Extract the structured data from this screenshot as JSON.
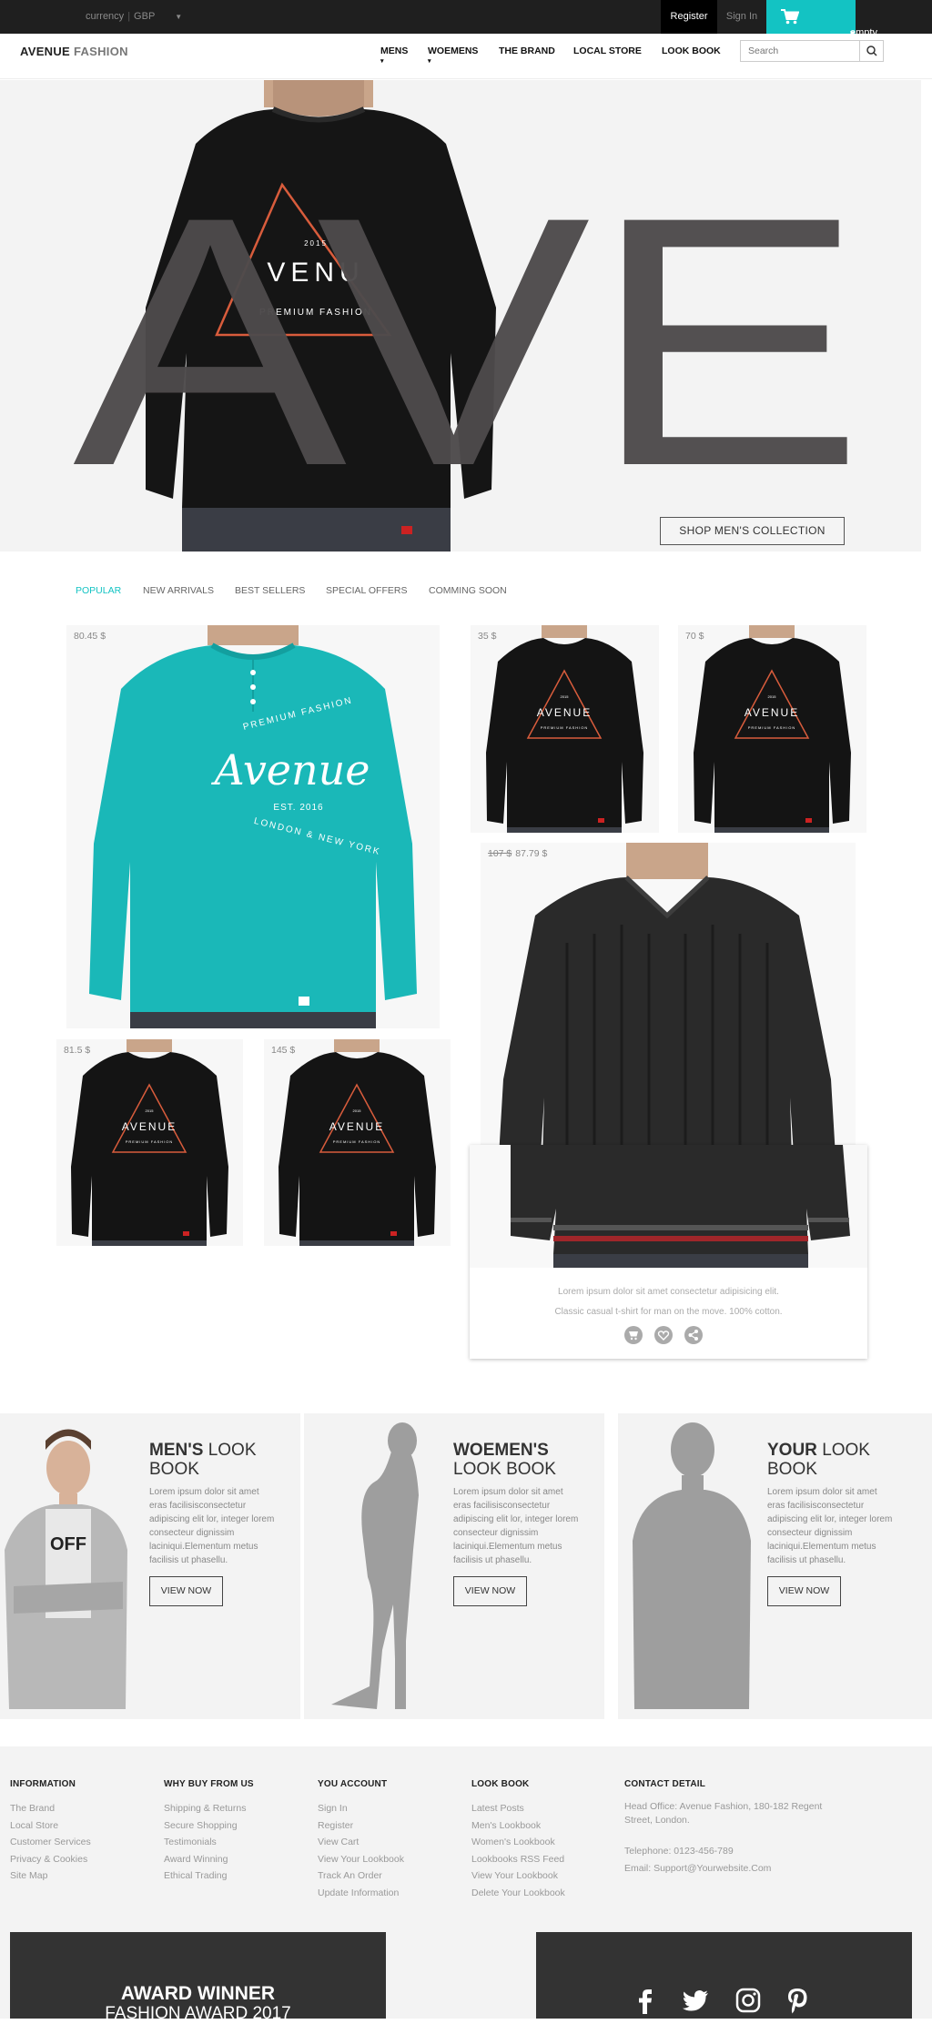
{
  "topbar": {
    "currency_label": "currency",
    "currency_value": "GBP",
    "currency_caret": "▼",
    "register": "Register",
    "signin": "Sign In",
    "cart_label": "empty",
    "cart_caret": "▾"
  },
  "nav": {
    "logo_bold": "AVENUE",
    "logo_light": "FASHION",
    "items": [
      "MENS",
      "WOEMENS",
      "THE BRAND",
      "LOCAL STORE",
      "LOOK BOOK"
    ],
    "dropdown_marker": "▾",
    "search_placeholder": "Search"
  },
  "hero": {
    "big_letters": "AVE",
    "shirt_year": "2015",
    "shirt_brand": "VENU",
    "shirt_tagline": "PREMIUM FASHION",
    "shop_button": "SHOP MEN'S COLLECTION"
  },
  "tabs": {
    "items": [
      "POPULAR",
      "NEW ARRIVALS",
      "BEST SELLERS",
      "SPECIAL OFFERS",
      "COMMING SOON"
    ],
    "active_index": 0
  },
  "products": [
    {
      "price": "80.45 $"
    },
    {
      "price": "35 $"
    },
    {
      "price": "70 $"
    },
    {
      "old_price": "107 $",
      "price": "87.79 $"
    },
    {
      "price": "81.5 $"
    },
    {
      "price": "145 $"
    }
  ],
  "product_art": {
    "teal_line1": "PREMIUM FASHION",
    "teal_script": "Avenue",
    "teal_est": "EST. 2016",
    "teal_line2": "LONDON & NEW YORK",
    "black_year": "2015",
    "black_brand": "AVENUE",
    "black_tagline": "PREMIUM FASHION"
  },
  "featured_detail": {
    "line1": "Lorem ipsum dolor sit amet consectetur adipisicing elit.",
    "line2": "Classic casual t-shirt for man on the move. 100% cotton.",
    "icons": [
      "cart-icon",
      "heart-icon",
      "share-icon"
    ]
  },
  "lookbooks": [
    {
      "title_bold": "MEN'S",
      "title_rest": "LOOK BOOK",
      "text": "Lorem ipsum dolor sit amet eras facilisisconsectetur adipiscing elit lor, integer lorem consecteur dignissim laciniqui.Elementum metus facilisis ut phasellu.",
      "button": "VIEW NOW"
    },
    {
      "title_bold": "WOEMEN'S",
      "title_rest": "LOOK BOOK",
      "text": "Lorem ipsum dolor sit amet eras facilisisconsectetur adipiscing elit lor, integer lorem consecteur dignissim laciniqui.Elementum metus facilisis ut phasellu.",
      "button": "VIEW NOW"
    },
    {
      "title_bold": "YOUR",
      "title_rest": "LOOK BOOK",
      "text": "Lorem ipsum dolor sit amet eras facilisisconsectetur adipiscing elit lor, integer lorem consecteur dignissim laciniqui.Elementum metus facilisis ut phasellu.",
      "button": "VIEW NOW"
    }
  ],
  "footer": {
    "columns": [
      {
        "title": "INFORMATION",
        "links": [
          "The Brand",
          "Local Store",
          "Customer Services",
          "Privacy & Cookies",
          "Site Map"
        ]
      },
      {
        "title": "WHY BUY FROM US",
        "links": [
          "Shipping & Returns",
          "Secure Shopping",
          "Testimonials",
          "Award Winning",
          "Ethical Trading"
        ]
      },
      {
        "title": "YOU ACCOUNT",
        "links": [
          "Sign In",
          "Register",
          "View Cart",
          "View Your Lookbook",
          "Track An Order",
          "Update Information"
        ]
      },
      {
        "title": "LOOK BOOK",
        "links": [
          "Latest Posts",
          "Men's Lookbook",
          "Women's Lookbook",
          "Lookbooks RSS Feed",
          "View Your Lookbook",
          "Delete Your Lookbook"
        ]
      }
    ],
    "contact": {
      "title": "CONTACT DETAIL",
      "address": "Head Office: Avenue Fashion, 180-182 Regent Street, London.",
      "telephone": "Telephone: 0123-456-789",
      "email": "Email: Support@Yourwebsite.Com"
    },
    "award_line1": "AWARD WINNER",
    "award_line2": "FASHION AWARD 2017",
    "social_icons": [
      "facebook-icon",
      "twitter-icon",
      "instagram-icon",
      "pinterest-icon"
    ]
  },
  "colors": {
    "accent": "#13c3c3",
    "topbar": "#1f1f1f",
    "dark_panel": "#333333",
    "light_panel": "#f3f3f3"
  }
}
